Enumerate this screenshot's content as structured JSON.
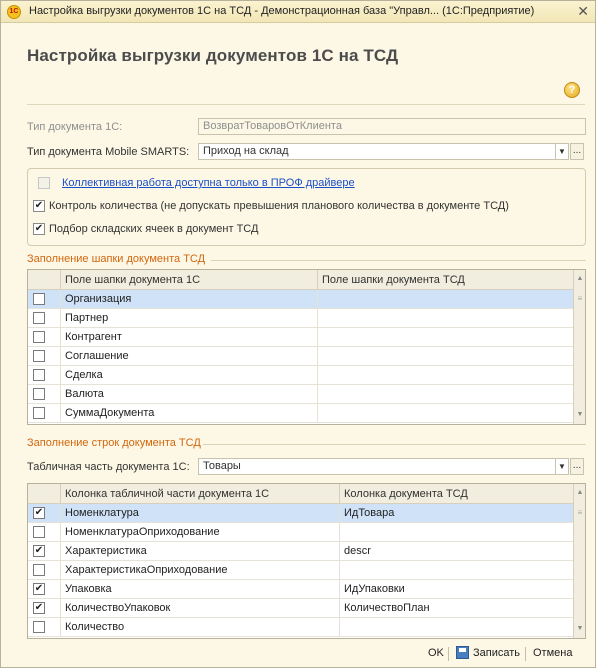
{
  "window": {
    "title": "Настройка выгрузки документов 1С на ТСД - Демонстрационная база \"Управл... (1С:Предприятие)",
    "app_icon_text": "1С",
    "close_glyph": "✕"
  },
  "form": {
    "heading": "Настройка выгрузки документов 1С на ТСД",
    "help_glyph": "?"
  },
  "fields": {
    "doc_type_1c_label": "Тип документа 1С:",
    "doc_type_1c_value": "ВозвратТоваровОтКлиента",
    "doc_type_ms_label": "Тип документа Mobile SMARTS:",
    "doc_type_ms_value": "Приход на склад"
  },
  "options": {
    "collective_work_link": "Коллективная работа доступна только в ПРОФ драйвере",
    "qty_control_label": "Контроль количества (не допускать превышения планового количества в документе ТСД)",
    "qty_control_checked": true,
    "cells_pick_label": "Подбор складских ячеек в документ ТСД",
    "cells_pick_checked": true
  },
  "header_section": {
    "title": "Заполнение шапки документа ТСД",
    "columns": [
      "Поле шапки документа 1С",
      "Поле шапки документа ТСД"
    ],
    "rows": [
      {
        "field_1c": "Организация",
        "field_tsd": "",
        "checked": false,
        "selected": true
      },
      {
        "field_1c": "Партнер",
        "field_tsd": "",
        "checked": false,
        "selected": false
      },
      {
        "field_1c": "Контрагент",
        "field_tsd": "",
        "checked": false,
        "selected": false
      },
      {
        "field_1c": "Соглашение",
        "field_tsd": "",
        "checked": false,
        "selected": false
      },
      {
        "field_1c": "Сделка",
        "field_tsd": "",
        "checked": false,
        "selected": false
      },
      {
        "field_1c": "Валюта",
        "field_tsd": "",
        "checked": false,
        "selected": false
      },
      {
        "field_1c": "СуммаДокумента",
        "field_tsd": "",
        "checked": false,
        "selected": false
      }
    ]
  },
  "lines_section": {
    "title": "Заполнение строк документа ТСД",
    "table_part_label": "Табличная часть документа 1С:",
    "table_part_value": "Товары",
    "columns": [
      "Колонка табличной части документа 1С",
      "Колонка документа ТСД"
    ],
    "rows": [
      {
        "col_1c": "Номенклатура",
        "col_tsd": "ИдТовара",
        "checked": true,
        "selected": true
      },
      {
        "col_1c": "НоменклатураОприходование",
        "col_tsd": "",
        "checked": false,
        "selected": false
      },
      {
        "col_1c": "Характеристика",
        "col_tsd": "descr",
        "checked": true,
        "selected": false
      },
      {
        "col_1c": "ХарактеристикаОприходование",
        "col_tsd": "",
        "checked": false,
        "selected": false
      },
      {
        "col_1c": "Упаковка",
        "col_tsd": "ИдУпаковки",
        "checked": true,
        "selected": false
      },
      {
        "col_1c": "КоличествоУпаковок",
        "col_tsd": "КоличествоПлан",
        "checked": true,
        "selected": false
      },
      {
        "col_1c": "Количество",
        "col_tsd": "",
        "checked": false,
        "selected": false
      }
    ]
  },
  "footer": {
    "ok_label": "OK",
    "save_label": "Записать",
    "cancel_label": "Отмена"
  },
  "glyphs": {
    "dropdown": "▼",
    "ellipsis": "...",
    "check": "✔",
    "scroll_up": "▲",
    "scroll_down": "▼",
    "scroll_thumb": "≡"
  },
  "colors": {
    "section_title": "#d0670e",
    "link": "#1b4fc8",
    "selected_row": "#cfe2f8",
    "background": "#fdf8e6"
  },
  "icons": {
    "app": "1c-logo-icon",
    "help": "help-icon",
    "save": "floppy-disk-icon",
    "close": "close-icon"
  }
}
